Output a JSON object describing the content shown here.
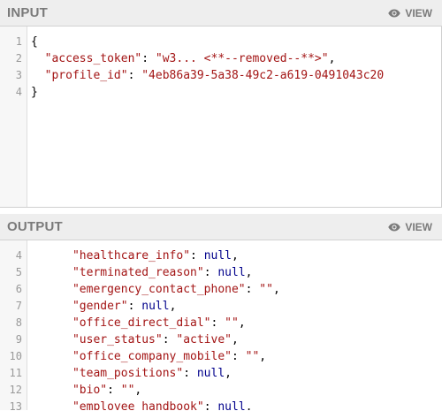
{
  "input": {
    "title": "INPUT",
    "view_label": "VIEW",
    "lines": [
      {
        "num": "1",
        "indent": "",
        "key": "",
        "value": "",
        "prefix": "{",
        "suffix": ""
      },
      {
        "num": "2",
        "indent": "  ",
        "key": "\"access_token\"",
        "value": "\"w3... <**--removed--**>\"",
        "prefix": "",
        "suffix": ","
      },
      {
        "num": "3",
        "indent": "  ",
        "key": "\"profile_id\"",
        "value": "\"4eb86a39-5a38-49c2-a619-0491043c20",
        "prefix": "",
        "suffix": ""
      },
      {
        "num": "4",
        "indent": "",
        "key": "",
        "value": "",
        "prefix": "}",
        "suffix": ""
      }
    ]
  },
  "output": {
    "title": "OUTPUT",
    "view_label": "VIEW",
    "lines": [
      {
        "num": "4",
        "key": "\"healthcare_info\"",
        "value": "null",
        "vtype": "k"
      },
      {
        "num": "5",
        "key": "\"terminated_reason\"",
        "value": "null",
        "vtype": "k"
      },
      {
        "num": "6",
        "key": "\"emergency_contact_phone\"",
        "value": "\"\"",
        "vtype": "s"
      },
      {
        "num": "7",
        "key": "\"gender\"",
        "value": "null",
        "vtype": "k"
      },
      {
        "num": "8",
        "key": "\"office_direct_dial\"",
        "value": "\"\"",
        "vtype": "s"
      },
      {
        "num": "9",
        "key": "\"user_status\"",
        "value": "\"active\"",
        "vtype": "s"
      },
      {
        "num": "10",
        "key": "\"office_company_mobile\"",
        "value": "\"\"",
        "vtype": "s"
      },
      {
        "num": "11",
        "key": "\"team_positions\"",
        "value": "null",
        "vtype": "k"
      },
      {
        "num": "12",
        "key": "\"bio\"",
        "value": "\"\"",
        "vtype": "s"
      },
      {
        "num": "13",
        "key": "\"employee_handbook\"",
        "value": "null",
        "vtype": "k"
      }
    ]
  },
  "colors": {
    "string": "#a31515",
    "keyword": "#00008b",
    "header_bg": "#eeeeee",
    "header_text": "#7a7a7a"
  },
  "icons": {
    "view": "eye-icon"
  }
}
